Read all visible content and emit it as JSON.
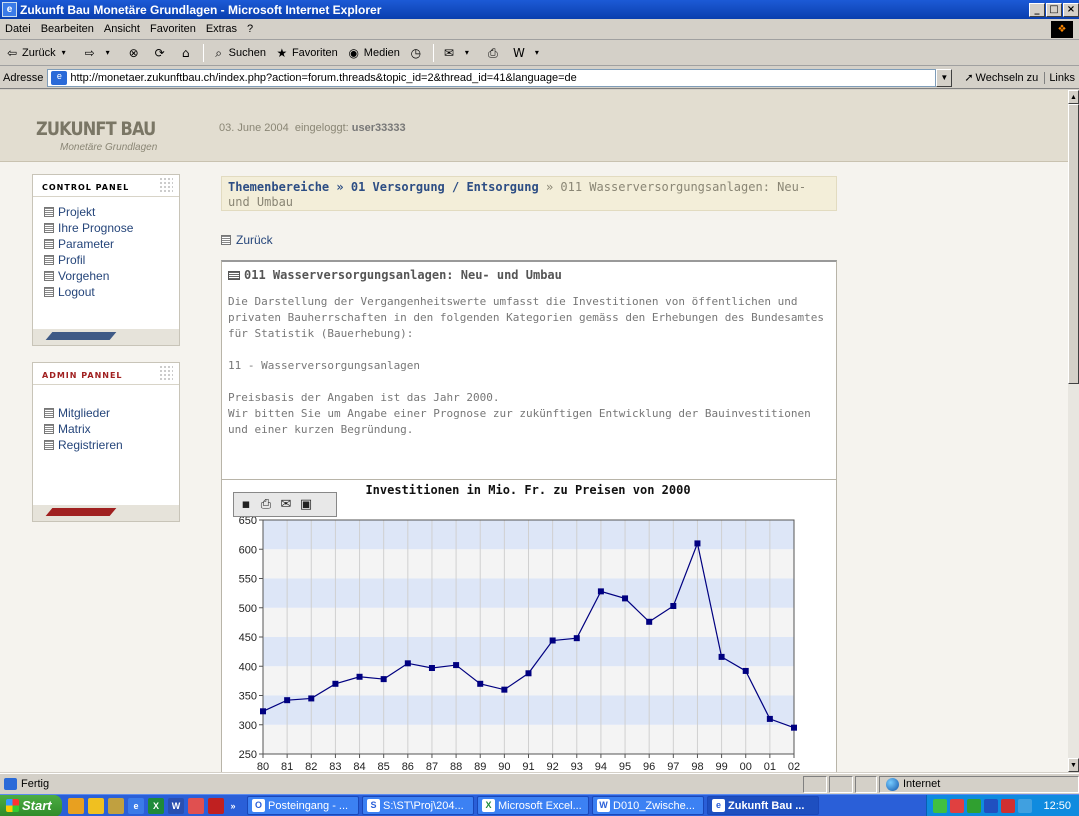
{
  "window": {
    "title": "Zukunft Bau Monetäre Grundlagen - Microsoft Internet Explorer",
    "controls": [
      "_",
      "□",
      "×"
    ]
  },
  "menu": [
    "Datei",
    "Bearbeiten",
    "Ansicht",
    "Favoriten",
    "Extras",
    "?"
  ],
  "toolbar": {
    "back": "Zurück",
    "search": "Suchen",
    "favorites": "Favoriten",
    "media": "Medien"
  },
  "address": {
    "label": "Adresse",
    "url": "http://monetaer.zukunftbau.ch/index.php?action=forum.threads&topic_id=2&thread_id=41&language=de",
    "go": "Wechseln zu",
    "links": "Links"
  },
  "site": {
    "logo": "ZUKUNFT BAU",
    "logo_sub": "Monetäre Grundlagen",
    "date": "03. June 2004",
    "logged_in_label": "eingeloggt:",
    "user": "user33333"
  },
  "control_panel": {
    "title": "CONTROL PANEL",
    "items": [
      "Projekt",
      "Ihre Prognose",
      "Parameter",
      "Profil",
      "Vorgehen",
      "Logout"
    ],
    "accent": "#3f5a86"
  },
  "admin_panel": {
    "title": "ADMIN PANNEL",
    "items": [
      "Mitglieder",
      "Matrix",
      "Registrieren"
    ],
    "accent": "#a02020"
  },
  "breadcrumb": {
    "level1": "Themenbereiche",
    "level2": "01 Versorgung / Entsorgung",
    "current": "011 Wasserversorgungsanlagen: Neu- und Umbau",
    "separator": "»"
  },
  "back_link": "Zurück",
  "content": {
    "title": "011 Wasserversorgungsanlagen: Neu- und Umbau",
    "paragraph1": "Die Darstellung der Vergangenheitswerte umfasst die Investitionen von öffentlichen und privaten Bauherrschaften in den folgenden Kategorien gemäss den Erhebungen des Bundesamtes für Statistik (Bauerhebung):",
    "paragraph2": "11 - Wasserversorgungsanlagen",
    "paragraph3": "Preisbasis der Angaben ist das Jahr 2000.\nWir bitten Sie um Angabe einer Prognose zur zukünftigen Entwicklung der Bauinvestitionen und einer kurzen Begründung."
  },
  "chart_tools": [
    "save-icon",
    "print-icon",
    "mail-icon",
    "image-icon"
  ],
  "chart_data": {
    "type": "line",
    "title": "Investitionen in Mio. Fr. zu  Preisen von 2000",
    "xlabel": "",
    "ylabel": "",
    "categories": [
      "80",
      "81",
      "82",
      "83",
      "84",
      "85",
      "86",
      "87",
      "88",
      "89",
      "90",
      "91",
      "92",
      "93",
      "94",
      "95",
      "96",
      "97",
      "98",
      "99",
      "00",
      "01",
      "02"
    ],
    "series": [
      {
        "values": [
          323,
          342,
          345,
          370,
          382,
          378,
          405,
          397,
          402,
          370,
          360,
          388,
          444,
          448,
          528,
          516,
          476,
          503,
          610,
          416,
          392,
          310,
          295
        ]
      }
    ],
    "ylim": [
      250,
      650
    ],
    "yticks": [
      250,
      300,
      350,
      400,
      450,
      500,
      550,
      600,
      650
    ],
    "line_color": "#000080",
    "band_colors": [
      "#dde6f7",
      "#f4f4f4"
    ]
  },
  "status": {
    "text": "Fertig",
    "zone": "Internet"
  },
  "taskbar": {
    "start": "Start",
    "tasks": [
      {
        "label": "Posteingang - ...",
        "active": false
      },
      {
        "label": "S:\\ST\\Proj\\204...",
        "active": false
      },
      {
        "label": "Microsoft Excel...",
        "active": false
      },
      {
        "label": "D010_Zwische...",
        "active": false
      },
      {
        "label": "Zukunft Bau ...",
        "active": true
      }
    ],
    "clock": "12:50"
  }
}
